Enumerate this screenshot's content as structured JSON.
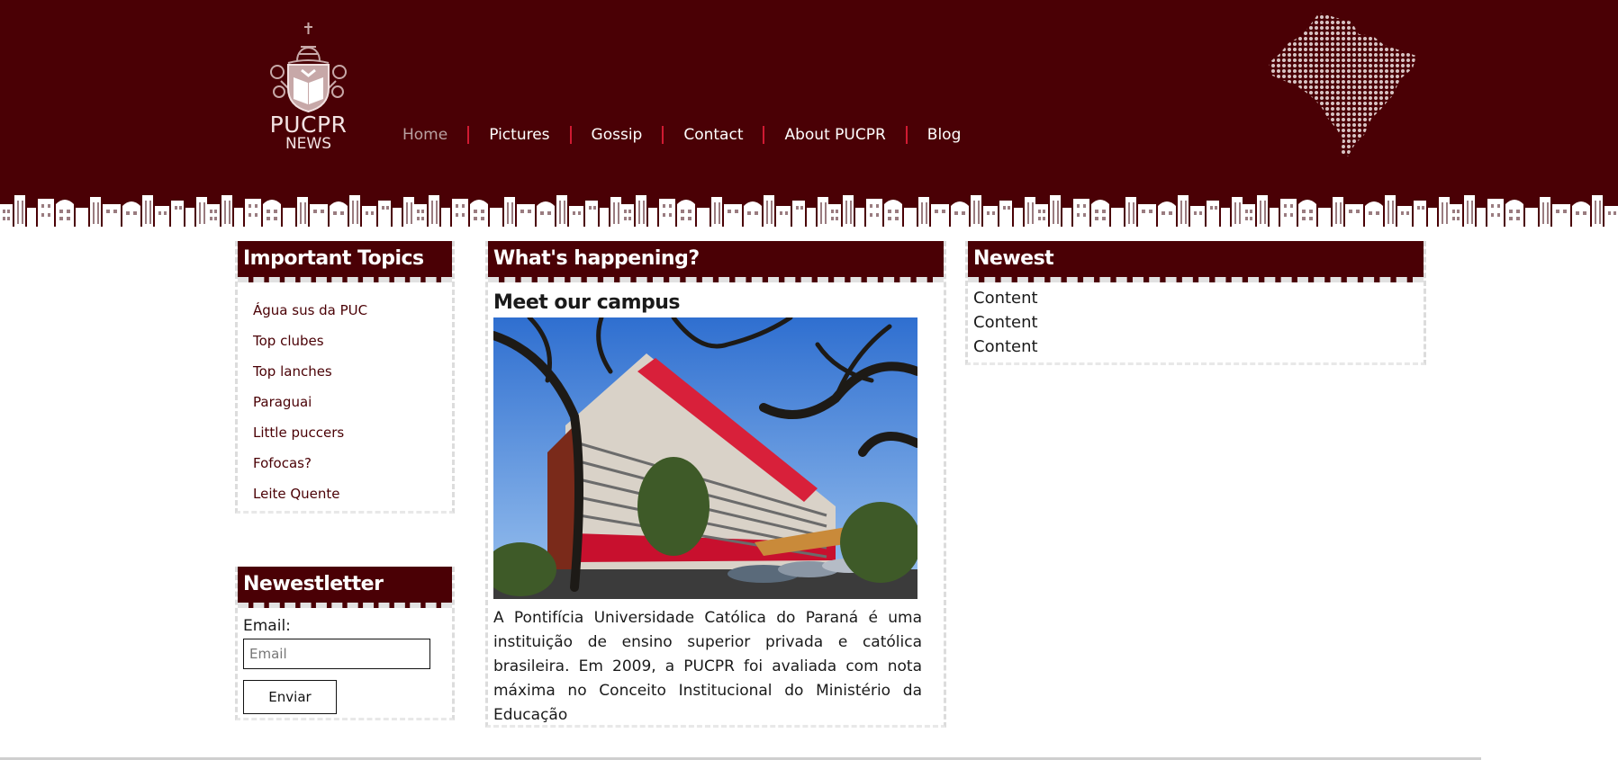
{
  "header": {
    "logo_title": "PUCPR",
    "logo_subtitle": "NEWS",
    "nav": [
      {
        "label": "Home",
        "active": true
      },
      {
        "label": "Pictures"
      },
      {
        "label": "Gossip"
      },
      {
        "label": "Contact"
      },
      {
        "label": "About PUCPR"
      },
      {
        "label": "Blog"
      }
    ],
    "colors": {
      "brand": "#4a0005",
      "separator": "#d01a32"
    }
  },
  "sidebar": {
    "topics_title": "Important Topics",
    "topics": [
      "Água sus da PUC",
      "Top clubes",
      "Top lanches",
      "Paraguai",
      "Little puccers",
      "Fofocas?",
      "Leite Quente"
    ],
    "newsletter": {
      "title": "Newestletter",
      "email_label": "Email:",
      "email_placeholder": "Email",
      "email_value": "",
      "submit_label": "Enviar"
    }
  },
  "main": {
    "title": "What's happening?",
    "article_title": "Meet our campus",
    "article_text": "A Pontifícia Universidade Católica do Paraná é uma instituição de ensino superior privada e católica brasileira. Em 2009, a PUCPR foi avaliada com nota máxima no Conceito Institucional do Ministério da Educação"
  },
  "newest": {
    "title": "Newest",
    "items": [
      "Content",
      "Content",
      "Content"
    ]
  }
}
